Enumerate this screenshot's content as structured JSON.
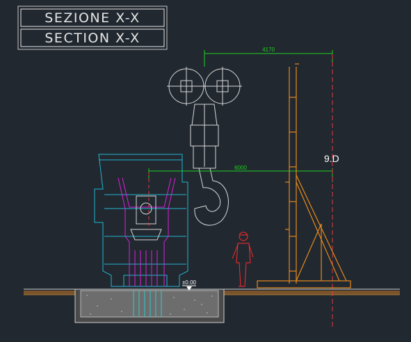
{
  "title": {
    "line1": "SEZIONE X-X",
    "line2": "SECTION X-X"
  },
  "dimensions": {
    "top": "4170",
    "middle": "6000"
  },
  "grid_label": "9.D",
  "level_label": "±0.00",
  "colors": {
    "background": "#212830",
    "frame": "#e6e6e6",
    "dimension": "#1fd01f",
    "ladle": "#22b6d2",
    "ladle_inner": "#e021e0",
    "crane_hook": "#d9d9d9",
    "tower": "#e88a1c",
    "person": "#ff2b2b",
    "axis": "#e23b3b",
    "ground_fill": "#8a5a2a"
  }
}
